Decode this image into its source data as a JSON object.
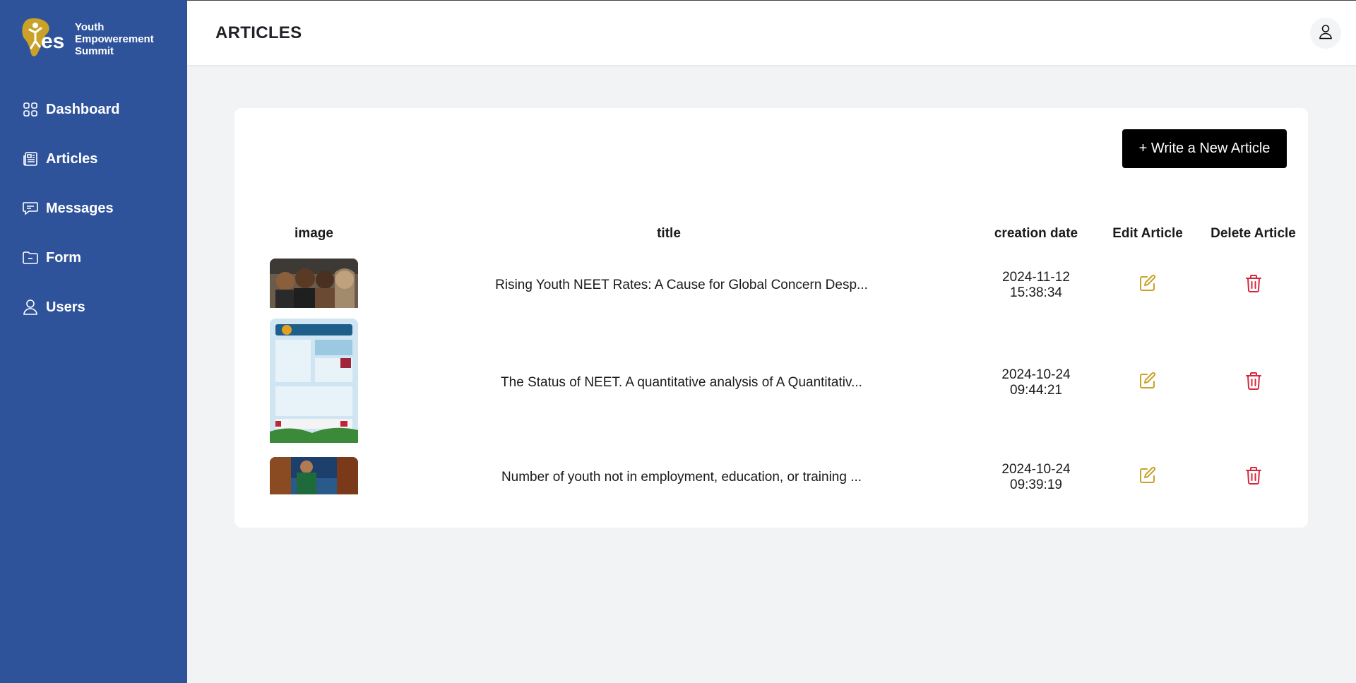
{
  "brand": {
    "logo_mark": "yes",
    "name_line1": "Youth",
    "name_line2": "Empowerement",
    "name_line3": "Summit",
    "colors": {
      "sidebar": "#2f539b",
      "logo_gold": "#c9a227"
    }
  },
  "sidebar": {
    "items": [
      {
        "label": "Dashboard",
        "icon": "grid-icon"
      },
      {
        "label": "Articles",
        "icon": "newspaper-icon"
      },
      {
        "label": "Messages",
        "icon": "chat-icon"
      },
      {
        "label": "Form",
        "icon": "folder-icon"
      },
      {
        "label": "Users",
        "icon": "user-icon"
      }
    ]
  },
  "header": {
    "title": "ARTICLES",
    "user_icon": "user-icon"
  },
  "main": {
    "new_article_label": "+ Write a New Article",
    "columns": {
      "image": "image",
      "title": "title",
      "creation_date": "creation date",
      "edit": "Edit Article",
      "delete": "Delete Article"
    },
    "rows": [
      {
        "title": "Rising Youth NEET Rates: A Cause for Global Concern Desp...",
        "date": "2024-11-12 15:38:34",
        "image": "group-of-young-people-photo"
      },
      {
        "title": "The Status of NEET. A quantitative analysis of A Quantitativ...",
        "date": "2024-10-24 09:44:21",
        "image": "infographic-poster"
      },
      {
        "title": "Number of youth not in employment, education, or training ...",
        "date": "2024-10-24 09:39:19",
        "image": "young-man-photo"
      }
    ],
    "colors": {
      "edit": "#c9a227",
      "delete": "#d7263d",
      "button": "#000000"
    }
  }
}
